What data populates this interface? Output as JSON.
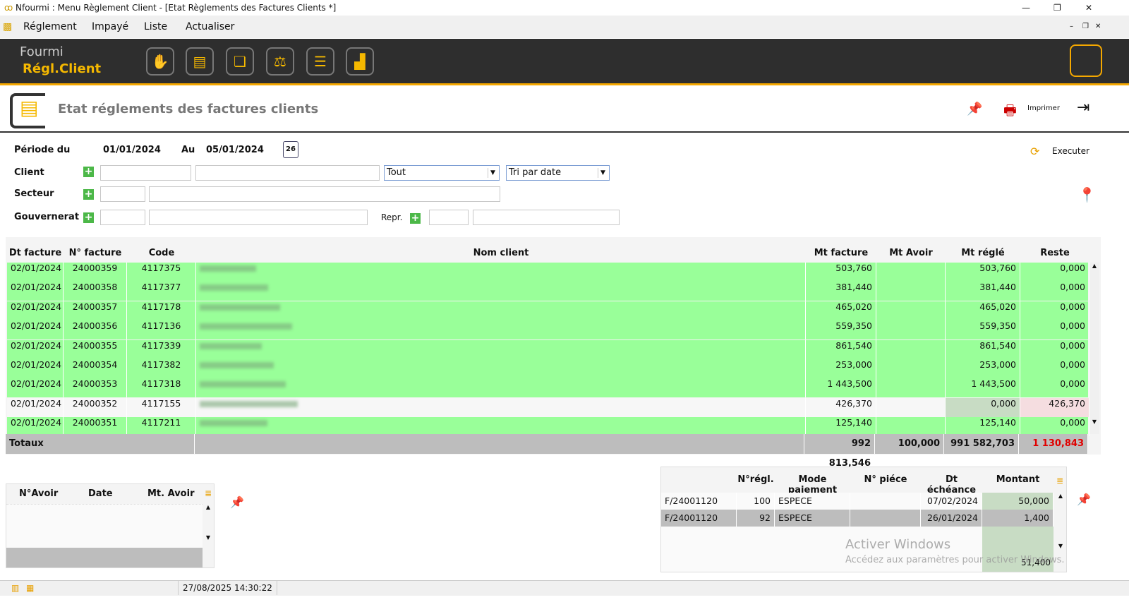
{
  "window": {
    "title": "Nfourmi : Menu Règlement Client - [Etat Règlements des Factures Clients *]"
  },
  "menu": [
    "Réglement",
    "Impayé",
    "Liste",
    "Actualiser"
  ],
  "toolbar": {
    "logo_top": "Fourmi",
    "logo_bottom": "Régl.Client",
    "icons": [
      "hand-coins-icon",
      "client-card-icon",
      "documents-icon",
      "balance-scale-icon",
      "list-document-icon",
      "chart-icon"
    ]
  },
  "page": {
    "title": "Etat réglements des factures clients",
    "print_label": "Imprimer",
    "execute_label": "Executer"
  },
  "filters": {
    "periode_label": "Période du",
    "date_from": "01/01/2024",
    "au_label": "Au",
    "date_to": "05/01/2024",
    "calendar_day": "26",
    "client_label": "Client",
    "secteur_label": "Secteur",
    "gouvernerat_label": "Gouvernerat",
    "repr_label": "Repr.",
    "client_filter": "Tout",
    "sort": "Tri par date"
  },
  "grid": {
    "headers": [
      "Dt facture",
      "N° facture",
      "Code",
      "Nom client",
      "Mt facture",
      "Mt Avoir",
      "Mt réglé",
      "Reste"
    ],
    "rows": [
      {
        "date": "02/01/2024",
        "num": "24000359",
        "code": "4117375",
        "mt": "503,760",
        "avoir": "",
        "regle": "503,760",
        "reste": "0,000",
        "paid": true
      },
      {
        "date": "02/01/2024",
        "num": "24000358",
        "code": "4117377",
        "mt": "381,440",
        "avoir": "",
        "regle": "381,440",
        "reste": "0,000",
        "paid": true
      },
      {
        "date": "02/01/2024",
        "num": "24000357",
        "code": "4117178",
        "mt": "465,020",
        "avoir": "",
        "regle": "465,020",
        "reste": "0,000",
        "paid": true
      },
      {
        "date": "02/01/2024",
        "num": "24000356",
        "code": "4117136",
        "mt": "559,350",
        "avoir": "",
        "regle": "559,350",
        "reste": "0,000",
        "paid": true
      },
      {
        "date": "02/01/2024",
        "num": "24000355",
        "code": "4117339",
        "mt": "861,540",
        "avoir": "",
        "regle": "861,540",
        "reste": "0,000",
        "paid": true
      },
      {
        "date": "02/01/2024",
        "num": "24000354",
        "code": "4117382",
        "mt": "253,000",
        "avoir": "",
        "regle": "253,000",
        "reste": "0,000",
        "paid": true
      },
      {
        "date": "02/01/2024",
        "num": "24000353",
        "code": "4117318",
        "mt": "1 443,500",
        "avoir": "",
        "regle": "1 443,500",
        "reste": "0,000",
        "paid": true
      },
      {
        "date": "02/01/2024",
        "num": "24000352",
        "code": "4117155",
        "mt": "426,370",
        "avoir": "",
        "regle": "0,000",
        "reste": "426,370",
        "paid": false
      },
      {
        "date": "02/01/2024",
        "num": "24000351",
        "code": "4117211",
        "mt": "125,140",
        "avoir": "",
        "regle": "125,140",
        "reste": "0,000",
        "paid": true
      }
    ],
    "totals": {
      "label": "Totaux",
      "mt": "992 813,546",
      "avoir": "100,000",
      "regle": "991 582,703",
      "reste": "1 130,843"
    }
  },
  "avoirs": {
    "headers": [
      "N°Avoir",
      "Date",
      "Mt. Avoir"
    ]
  },
  "reglements": {
    "headers": [
      "",
      "N°régl.",
      "Mode paiement",
      "N° piéce",
      "Dt échéance",
      "Montant"
    ],
    "rows": [
      {
        "ref": "F/24001120",
        "num": "100",
        "mode": "ESPECE",
        "piece": "",
        "echeance": "07/02/2024",
        "montant": "50,000"
      },
      {
        "ref": "F/24001120",
        "num": "92",
        "mode": "ESPECE",
        "piece": "",
        "echeance": "26/01/2024",
        "montant": "1,400"
      }
    ],
    "total": "51,400"
  },
  "watermark": {
    "line1": "Activer Windows",
    "line2": "Accédez aux paramètres pour activer Windows."
  },
  "status": {
    "datetime": "27/08/2025  14:30:22"
  },
  "colors": {
    "paid": "#99ff99",
    "unpaid": "#f7f7f7",
    "accent": "#f5a800",
    "toolbar": "#2e2e2e",
    "reste_total": "#e00000"
  }
}
